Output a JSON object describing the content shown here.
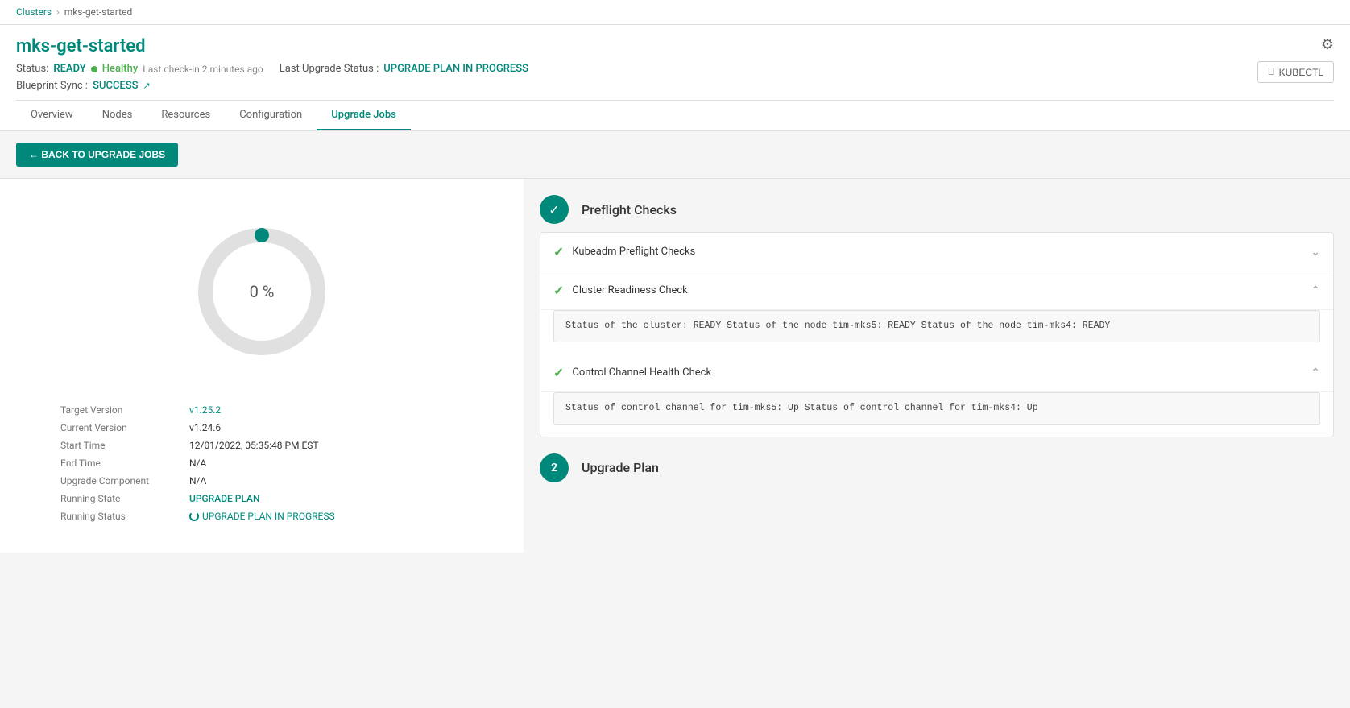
{
  "breadcrumb": {
    "clusters_label": "Clusters",
    "separator": "›",
    "current": "mks-get-started"
  },
  "cluster": {
    "title": "mks-get-started",
    "status_label": "Status:",
    "status_value": "READY",
    "health_label": "Healthy",
    "last_checkin": "Last check-in 2 minutes ago",
    "upgrade_status_label": "Last Upgrade Status :",
    "upgrade_status_value": "UPGRADE PLAN IN PROGRESS",
    "blueprint_label": "Blueprint Sync :",
    "blueprint_value": "SUCCESS",
    "kubectl_label": "KUBECTL"
  },
  "tabs": [
    {
      "label": "Overview",
      "active": false
    },
    {
      "label": "Nodes",
      "active": false
    },
    {
      "label": "Resources",
      "active": false
    },
    {
      "label": "Configuration",
      "active": false
    },
    {
      "label": "Upgrade Jobs",
      "active": true
    }
  ],
  "back_button": "← BACK TO UPGRADE JOBS",
  "progress": {
    "percent": "0 %",
    "donut_value": 0
  },
  "info": {
    "target_version_label": "Target Version",
    "target_version_value": "v1.25.2",
    "current_version_label": "Current Version",
    "current_version_value": "v1.24.6",
    "start_time_label": "Start Time",
    "start_time_value": "12/01/2022, 05:35:48 PM EST",
    "end_time_label": "End Time",
    "end_time_value": "N/A",
    "upgrade_component_label": "Upgrade Component",
    "upgrade_component_value": "N/A",
    "running_state_label": "Running State",
    "running_state_value": "UPGRADE PLAN",
    "running_status_label": "Running Status",
    "running_status_value": "UPGRADE PLAN IN PROGRESS"
  },
  "preflight": {
    "section_title": "Preflight Checks",
    "checks": [
      {
        "label": "Kubeadm Preflight Checks",
        "expanded": false,
        "details": null
      },
      {
        "label": "Cluster Readiness Check",
        "expanded": true,
        "details": "Status of the cluster: READY\nStatus of the node tim-mks5: READY\nStatus of the node tim-mks4: READY"
      },
      {
        "label": "Control Channel Health Check",
        "expanded": true,
        "details": "Status of control channel for tim-mks5: Up\nStatus of control channel for tim-mks4: Up"
      }
    ]
  },
  "upgrade_plan": {
    "number": "2",
    "title": "Upgrade Plan"
  }
}
